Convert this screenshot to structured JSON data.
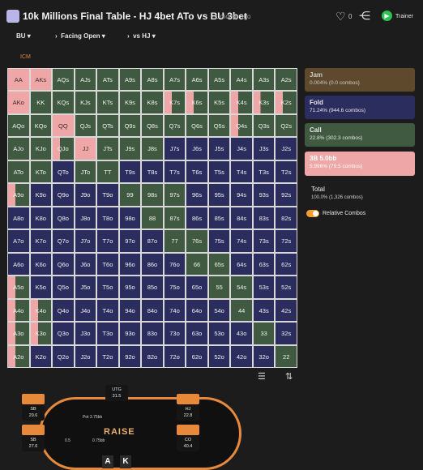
{
  "header": {
    "title": "10k Millions Final Table - HJ 4bet ATo vs BU 3bet",
    "time_ago": "1 month ago",
    "likes": "0",
    "trainer_label": "Trainer"
  },
  "breadcrumb": [
    "BU",
    "Facing Open",
    "vs HJ"
  ],
  "mode_label": "ICM",
  "grid": {
    "hands": [
      [
        "AA",
        "AKs",
        "AQs",
        "AJs",
        "ATs",
        "A9s",
        "A8s",
        "A7s",
        "A6s",
        "A5s",
        "A4s",
        "A3s",
        "A2s"
      ],
      [
        "AKo",
        "KK",
        "KQs",
        "KJs",
        "KTs",
        "K9s",
        "K8s",
        "K7s",
        "K6s",
        "K5s",
        "K4s",
        "K3s",
        "K2s"
      ],
      [
        "AQo",
        "KQo",
        "QQ",
        "QJs",
        "QTs",
        "Q9s",
        "Q8s",
        "Q7s",
        "Q6s",
        "Q5s",
        "Q4s",
        "Q3s",
        "Q2s"
      ],
      [
        "AJo",
        "KJo",
        "QJo",
        "JJ",
        "JTs",
        "J9s",
        "J8s",
        "J7s",
        "J6s",
        "J5s",
        "J4s",
        "J3s",
        "J2s"
      ],
      [
        "ATo",
        "KTo",
        "QTo",
        "JTo",
        "TT",
        "T9s",
        "T8s",
        "T7s",
        "T6s",
        "T5s",
        "T4s",
        "T3s",
        "T2s"
      ],
      [
        "A9o",
        "K9o",
        "Q9o",
        "J9o",
        "T9o",
        "99",
        "98s",
        "97s",
        "96s",
        "95s",
        "94s",
        "93s",
        "92s"
      ],
      [
        "A8o",
        "K8o",
        "Q8o",
        "J8o",
        "T8o",
        "98o",
        "88",
        "87s",
        "86s",
        "85s",
        "84s",
        "83s",
        "82s"
      ],
      [
        "A7o",
        "K7o",
        "Q7o",
        "J7o",
        "T7o",
        "97o",
        "87o",
        "77",
        "76s",
        "75s",
        "74s",
        "73s",
        "72s"
      ],
      [
        "A6o",
        "K6o",
        "Q6o",
        "J6o",
        "T6o",
        "96o",
        "86o",
        "76o",
        "66",
        "65s",
        "64s",
        "63s",
        "62s"
      ],
      [
        "A5o",
        "K5o",
        "Q5o",
        "J5o",
        "T5o",
        "95o",
        "85o",
        "75o",
        "65o",
        "55",
        "54s",
        "53s",
        "52s"
      ],
      [
        "A4o",
        "K4o",
        "Q4o",
        "J4o",
        "T4o",
        "94o",
        "84o",
        "74o",
        "64o",
        "54o",
        "44",
        "43s",
        "42s"
      ],
      [
        "A3o",
        "K3o",
        "Q3o",
        "J3o",
        "T3o",
        "93o",
        "83o",
        "73o",
        "63o",
        "53o",
        "43o",
        "33",
        "32s"
      ],
      [
        "A2o",
        "K2o",
        "Q2o",
        "J2o",
        "T2o",
        "92o",
        "82o",
        "72o",
        "62o",
        "52o",
        "42o",
        "32o",
        "22"
      ]
    ],
    "colors": [
      [
        "p",
        "p",
        "g",
        "g",
        "g",
        "g",
        "g",
        "g",
        "g",
        "g",
        "g",
        "g",
        "g"
      ],
      [
        "p",
        "g",
        "g",
        "g",
        "g",
        "g",
        "g",
        "s",
        "s",
        "g",
        "s",
        "s",
        "s"
      ],
      [
        "g",
        "g",
        "p",
        "g",
        "g",
        "g",
        "g",
        "g",
        "g",
        "g",
        "s",
        "g",
        "g"
      ],
      [
        "g",
        "g",
        "s",
        "p",
        "g",
        "g",
        "g",
        "b",
        "b",
        "b",
        "b",
        "b",
        "b"
      ],
      [
        "g",
        "g",
        "b",
        "g",
        "g",
        "b",
        "b",
        "b",
        "b",
        "b",
        "b",
        "b",
        "b"
      ],
      [
        "s",
        "b",
        "b",
        "b",
        "b",
        "g",
        "g",
        "g",
        "b",
        "b",
        "b",
        "b",
        "b"
      ],
      [
        "b",
        "b",
        "b",
        "b",
        "b",
        "b",
        "g",
        "g",
        "b",
        "b",
        "b",
        "b",
        "b"
      ],
      [
        "b",
        "b",
        "b",
        "b",
        "b",
        "b",
        "b",
        "g",
        "g",
        "b",
        "b",
        "b",
        "b"
      ],
      [
        "b",
        "b",
        "b",
        "b",
        "b",
        "b",
        "b",
        "b",
        "g",
        "g",
        "b",
        "b",
        "b"
      ],
      [
        "s",
        "b",
        "b",
        "b",
        "b",
        "b",
        "b",
        "b",
        "b",
        "g",
        "g",
        "b",
        "b"
      ],
      [
        "s",
        "s",
        "b",
        "b",
        "b",
        "b",
        "b",
        "b",
        "b",
        "b",
        "g",
        "b",
        "b"
      ],
      [
        "s",
        "s",
        "b",
        "b",
        "b",
        "b",
        "b",
        "b",
        "b",
        "b",
        "b",
        "g",
        "b"
      ],
      [
        "s",
        "b",
        "b",
        "b",
        "b",
        "b",
        "b",
        "b",
        "b",
        "b",
        "b",
        "b",
        "g"
      ]
    ]
  },
  "legend": [
    {
      "title": "Jam",
      "sub": "0.004% (0.0 combos)",
      "color": "#6b5230"
    },
    {
      "title": "Fold",
      "sub": "71.24% (944.6 combos)",
      "color": "#2a2d5e"
    },
    {
      "title": "Call",
      "sub": "22.8% (302.3 combos)",
      "color": "#3f5a40"
    },
    {
      "title": "3B 5.0bb",
      "sub": "5.996% (79.5 combos)",
      "color": "#eea6a6"
    }
  ],
  "total": {
    "label": "Total",
    "value": "100.0% (1,326 combos)"
  },
  "relative_combos_label": "Relative Combos",
  "table": {
    "seats": [
      {
        "pos": "UTG",
        "stack": "31.5"
      },
      {
        "pos": "HJ",
        "stack": "22.8"
      },
      {
        "pos": "CO",
        "stack": "40.4"
      },
      {
        "pos": "SB",
        "stack": "29.6"
      },
      {
        "pos": "SB",
        "stack": "27.6"
      }
    ],
    "pot": "Pot 3.75bb",
    "bet": "0.75bb",
    "bet2": "0.5",
    "logo": "RAISE",
    "hero_cards": [
      "A",
      "K"
    ]
  }
}
